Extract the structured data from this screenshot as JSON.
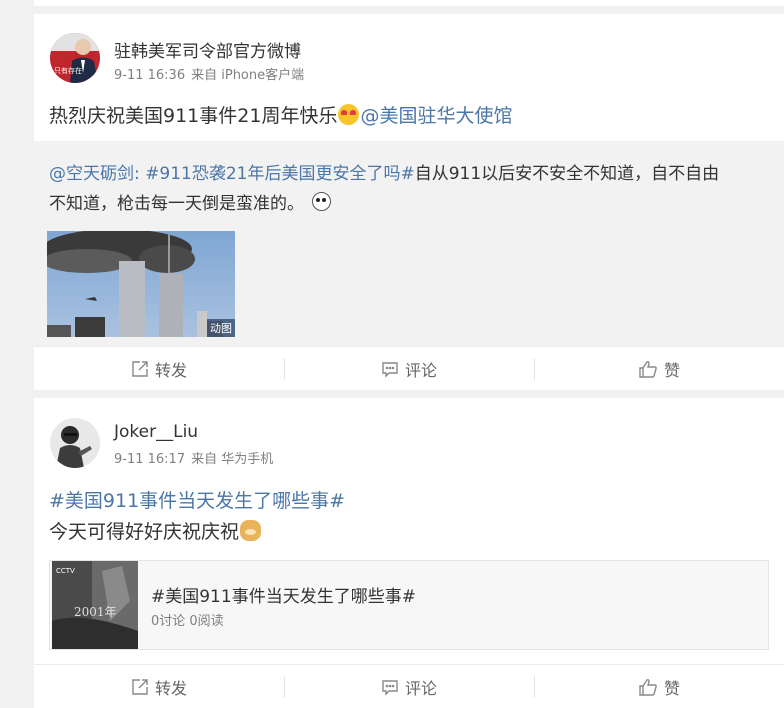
{
  "posts": [
    {
      "username": "驻韩美军司令部官方微博",
      "timestamp": "9-11 16:36",
      "source": "来自 iPhone客户端",
      "text": "热烈庆祝美国911事件21周年快乐",
      "mention": "@美国驻华大使馆",
      "avatar_text": "只有存在\n我中国心",
      "repost": {
        "user": "@空天砺剑:",
        "hashtag": "#911恐袭21年后美国更安全了吗#",
        "line1_rest": "自从911以后安不安全不知道，自不自由",
        "line2": "不知道，枪击每一天倒是蛮准的。",
        "gif_badge": "动图"
      },
      "actions": {
        "forward": "转发",
        "comment": "评论",
        "like": "赞"
      }
    },
    {
      "username": "Joker__Liu",
      "timestamp": "9-11 16:17",
      "source": "来自 华为手机",
      "hashtag": "#美国911事件当天发生了哪些事#",
      "text": "今天可得好好庆祝庆祝",
      "topic_card": {
        "title": "#美国911事件当天发生了哪些事#",
        "stats": "0讨论 0阅读",
        "thumb_logo": "CCTV",
        "thumb_year": "2001年"
      },
      "actions": {
        "forward": "转发",
        "comment": "评论",
        "like": "赞"
      }
    }
  ],
  "colors": {
    "link": "#4b76a8",
    "background": "#f1f1f1",
    "card": "#ffffff",
    "repost_bg": "#f2f2f2"
  },
  "icons": {
    "forward": "share-out-icon",
    "comment": "comment-bubble-icon",
    "like": "thumbs-up-icon"
  }
}
